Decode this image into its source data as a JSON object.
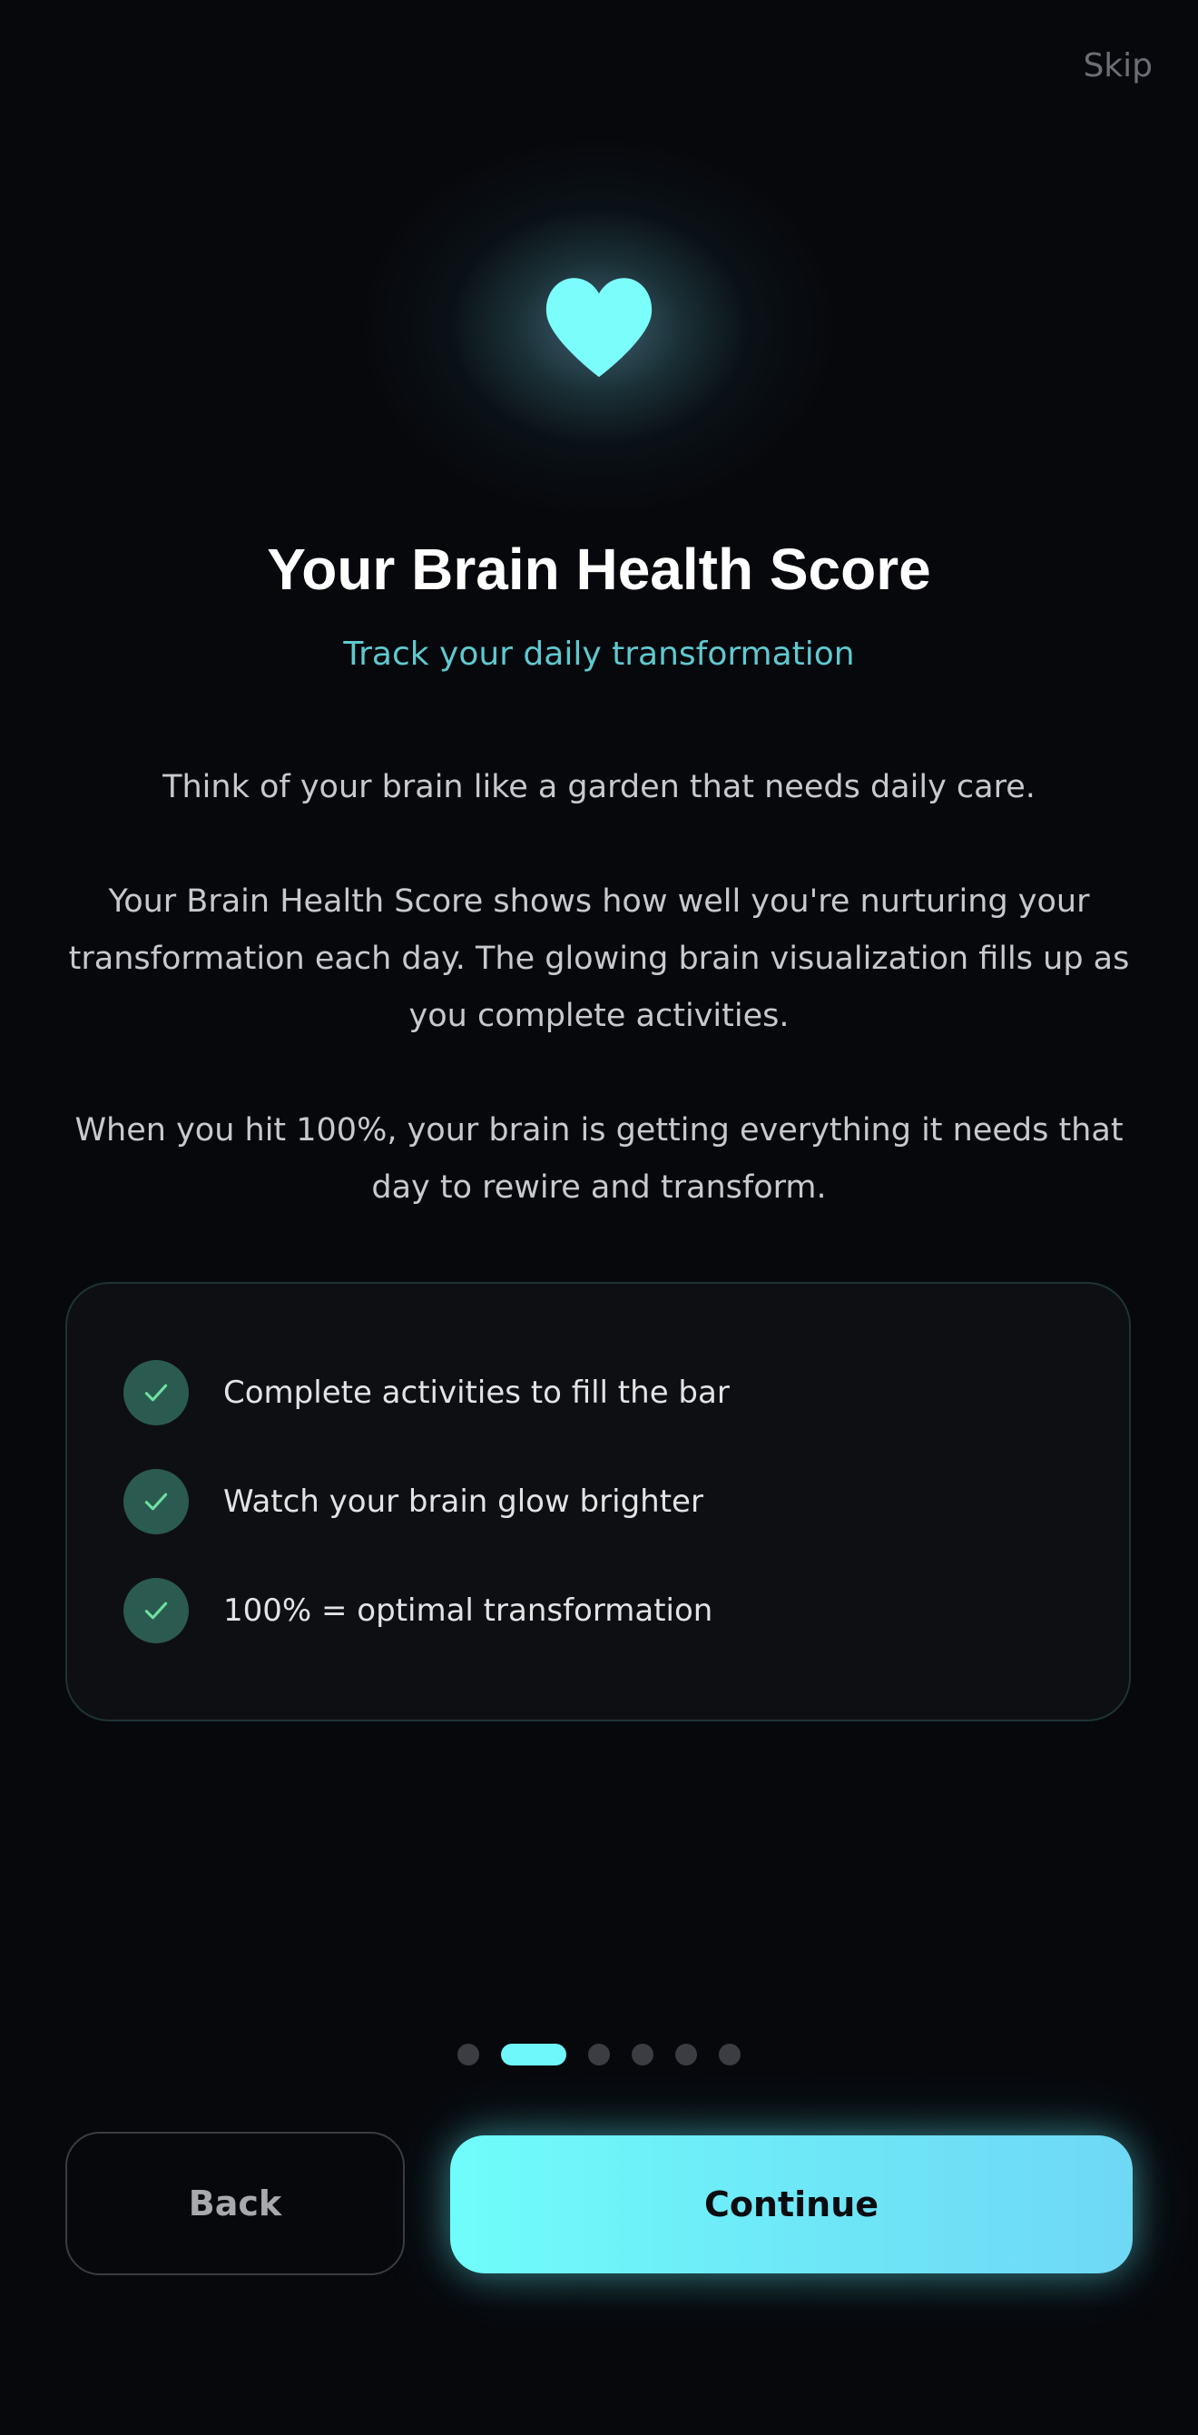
{
  "header": {
    "skip_label": "Skip"
  },
  "hero": {
    "icon": "heart-icon",
    "icon_color": "#7bfdfb"
  },
  "content": {
    "title": "Your Brain Health Score",
    "subtitle": "Track your daily transformation",
    "paragraphs": [
      "Think of your brain like a garden that needs daily care.",
      "Your Brain Health Score shows how well you're nurturing your transformation each day. The glowing brain visualization fills up as you complete activities.",
      "When you hit 100%, your brain is getting everything it needs that day to rewire and transform."
    ]
  },
  "features": {
    "items": [
      {
        "label": "Complete activities to fill the bar",
        "icon": "check-icon"
      },
      {
        "label": "Watch your brain glow brighter",
        "icon": "check-icon"
      },
      {
        "label": "100% = optimal transformation",
        "icon": "check-icon"
      }
    ]
  },
  "pagination": {
    "total": 6,
    "current": 2
  },
  "footer": {
    "back_label": "Back",
    "continue_label": "Continue"
  },
  "colors": {
    "background": "#07080c",
    "accent": "#6ff8fb",
    "subtitle": "#5fc9cf",
    "check_bg": "#2b5a50",
    "check_mark": "#6ee0a0"
  }
}
